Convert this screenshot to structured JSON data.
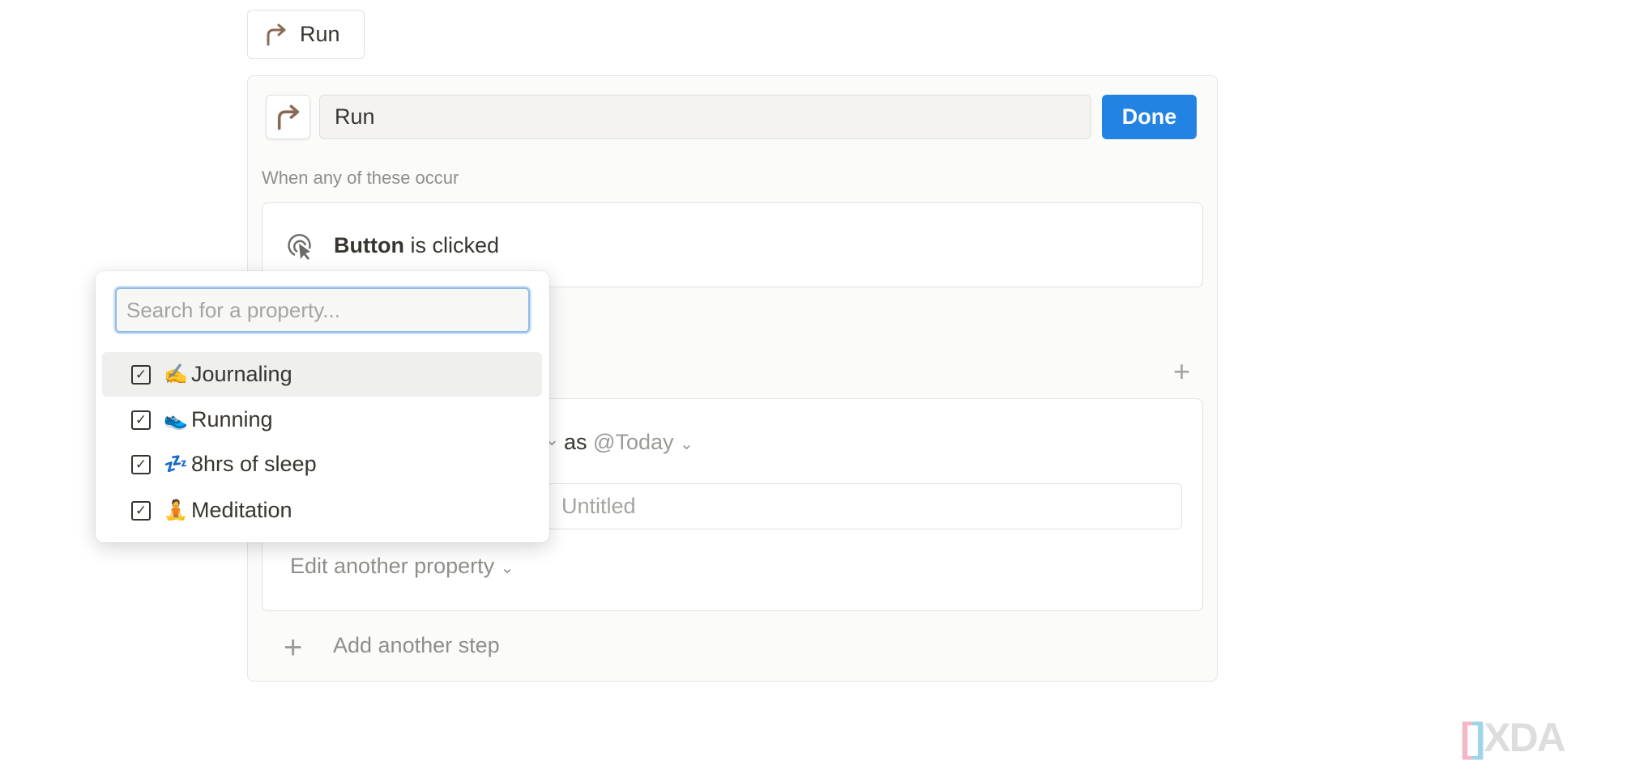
{
  "button_preview": {
    "label": "Run",
    "icon": "arrow-turn-up-right-icon"
  },
  "editor": {
    "name_value": "Run",
    "done_label": "Done",
    "trigger_heading": "When any of these occur",
    "trigger": {
      "bold": "Button",
      "rest": " is clicked",
      "icon": "cursor-click-icon"
    },
    "action": {
      "as_text": "as",
      "date_value": "@Today",
      "title_placeholder": "Untitled",
      "edit_another": "Edit another property"
    },
    "add_step_label": "Add another step"
  },
  "property_menu": {
    "search_placeholder": "Search for a property...",
    "items": [
      {
        "emoji": "✍️",
        "label": "Journaling",
        "checked": true
      },
      {
        "emoji": "👟",
        "label": "Running",
        "checked": true
      },
      {
        "emoji": "💤",
        "label": "8hrs of sleep",
        "checked": true
      },
      {
        "emoji": "🧘",
        "label": "Meditation",
        "checked": true
      }
    ]
  },
  "watermark": "XDA",
  "colors": {
    "accent": "#2383e2",
    "icon_brown": "#8b6a55"
  }
}
